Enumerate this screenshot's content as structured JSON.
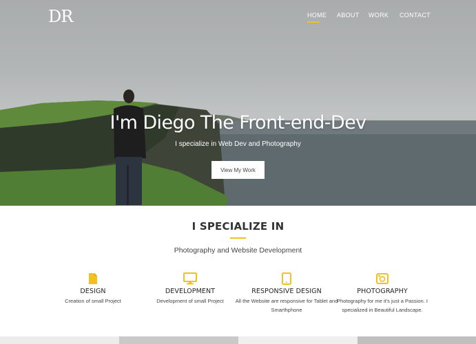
{
  "header": {
    "logo": "DR",
    "nav": [
      {
        "label": "HOME",
        "active": true
      },
      {
        "label": "ABOUT",
        "active": false
      },
      {
        "label": "WORK",
        "active": false
      },
      {
        "label": "CONTACT",
        "active": false
      }
    ]
  },
  "hero": {
    "title": "I'm Diego The Front-end-Dev",
    "subtitle": "I specialize in Web Dev and Photography",
    "button_label": "View My Work"
  },
  "specialize": {
    "title": "I SPECIALIZE IN",
    "subtitle": "Photography and Website Development",
    "services": [
      {
        "icon": "document-icon",
        "title": "DESIGN",
        "description": "Creation of small Project"
      },
      {
        "icon": "monitor-icon",
        "title": "DEVELOPMENT",
        "description": "Development of small Project"
      },
      {
        "icon": "tablet-icon",
        "title": "RESPONSIVE DESIGN",
        "description": "All the Website are responsive for Tablet and Smarthphone"
      },
      {
        "icon": "camera-icon",
        "title": "PHOTOGRAPHY",
        "description": "Photography for me it's just a Passion. I specialized in Beautiful Landscape."
      }
    ]
  },
  "colors": {
    "accent": "#f2c11d",
    "hero_text": "#ffffff",
    "heading_text": "#333333"
  }
}
